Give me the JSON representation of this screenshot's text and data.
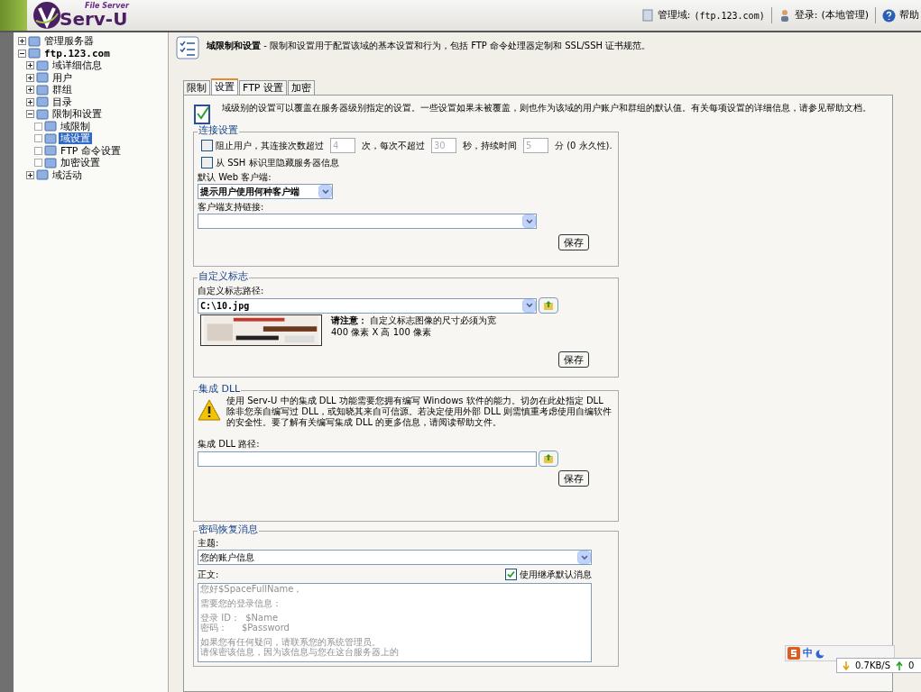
{
  "header": {
    "logo_small": "File Server",
    "logo": "Serv-U",
    "domain_label": "管理域:",
    "domain": "(ftp.123.com)",
    "login_label": "登录:",
    "login": "(本地管理)",
    "help": "帮助"
  },
  "sidebar": {
    "tree": [
      {
        "label": "管理服务器",
        "kind": "branch",
        "expanded": false,
        "selected": false
      },
      {
        "label": "ftp.123.com",
        "kind": "branch",
        "expanded": true,
        "selected": false,
        "children": [
          {
            "label": "域详细信息",
            "kind": "branch",
            "expanded": false,
            "selected": false
          },
          {
            "label": "用户",
            "kind": "branch",
            "expanded": false,
            "selected": false
          },
          {
            "label": "群组",
            "kind": "branch",
            "expanded": false,
            "selected": false
          },
          {
            "label": "目录",
            "kind": "branch",
            "expanded": false,
            "selected": false
          },
          {
            "label": "限制和设置",
            "kind": "branch",
            "expanded": true,
            "selected": false,
            "children": [
              {
                "label": "域限制",
                "kind": "leaf",
                "selected": false
              },
              {
                "label": "域设置",
                "kind": "leaf",
                "selected": true
              },
              {
                "label": "FTP 命令设置",
                "kind": "leaf",
                "selected": false
              },
              {
                "label": "加密设置",
                "kind": "leaf",
                "selected": false
              }
            ]
          },
          {
            "label": "域活动",
            "kind": "branch",
            "expanded": false,
            "selected": false
          }
        ]
      }
    ]
  },
  "page": {
    "title": "域限制和设置",
    "description": "- 限制和设置用于配置该域的基本设置和行为，包括 FTP 命令处理器定制和 SSL/SSH 证书规范。"
  },
  "tabs": [
    {
      "label": "限制",
      "selected": false
    },
    {
      "label": "设置",
      "selected": true
    },
    {
      "label": "FTP 设置",
      "selected": false
    },
    {
      "label": "加密",
      "selected": false
    }
  ],
  "intro": "域级别的设置可以覆盖在服务器级别指定的设置。一些设置如果未被覆盖，则也作为该域的用户账户和群组的默认值。有关每项设置的详细信息，请参见帮助文档。",
  "connection": {
    "legend": "连接设置",
    "block": {
      "checked": false,
      "label": "阻止用户，其连接次数超过",
      "value_1": "4",
      "text_2": "次，每次不超过",
      "value_2": "30",
      "text_3": "秒，持续时间",
      "value_3": "5",
      "text_4": "分 (0 永久性)."
    },
    "hide_ssh": {
      "checked": false,
      "label": "从 SSH 标识里隐藏服务器信息"
    },
    "web_client_label": "默认 Web 客户端:",
    "web_client_value": "提示用户使用何种客户端",
    "links_label": "客户端支持链接:",
    "save": "保存"
  },
  "logo_section": {
    "legend": "自定义标志",
    "path_label": "自定义标志路径:",
    "path_value": "C:\\10.jpg",
    "note_bold": "请注意：",
    "note_text": "自定义标志图像的尺寸必须为宽",
    "note_text_2": "400 像素 X 高 100 像素",
    "save": "保存"
  },
  "dll": {
    "legend": "集成 DLL",
    "warning": "使用 Serv-U 中的集成 DLL 功能需要您拥有编写 Windows 软件的能力。切勿在此处指定 DLL 除非您亲自编写过 DLL，或知晓其来自可信源。若决定使用外部 DLL 则需慎重考虑使用自编软件的安全性。要了解有关编写集成 DLL 的更多信息，请阅读帮助文件。",
    "path_label": "集成 DLL 路径:",
    "save": "保存"
  },
  "recovery": {
    "legend": "密码恢复消息",
    "subject_label": "主题:",
    "subject_value": "您的账户信息",
    "body_label": "正文:",
    "inherit": {
      "checked": true,
      "label": "使用继承默认消息"
    },
    "body_paragraphs": [
      [
        "您好$SpaceFullName，"
      ],
      [
        "需要您的登录信息："
      ],
      [
        "登录 ID：  $Name",
        "密码：     $Password"
      ],
      [
        "如果您有任何疑问，请联系您的系统管理员。",
        "请保密该信息，因为该信息与您在这台服务器上的"
      ]
    ]
  },
  "ime": {
    "mode": "中",
    "down": "0.7KB/S",
    "up": "0"
  }
}
